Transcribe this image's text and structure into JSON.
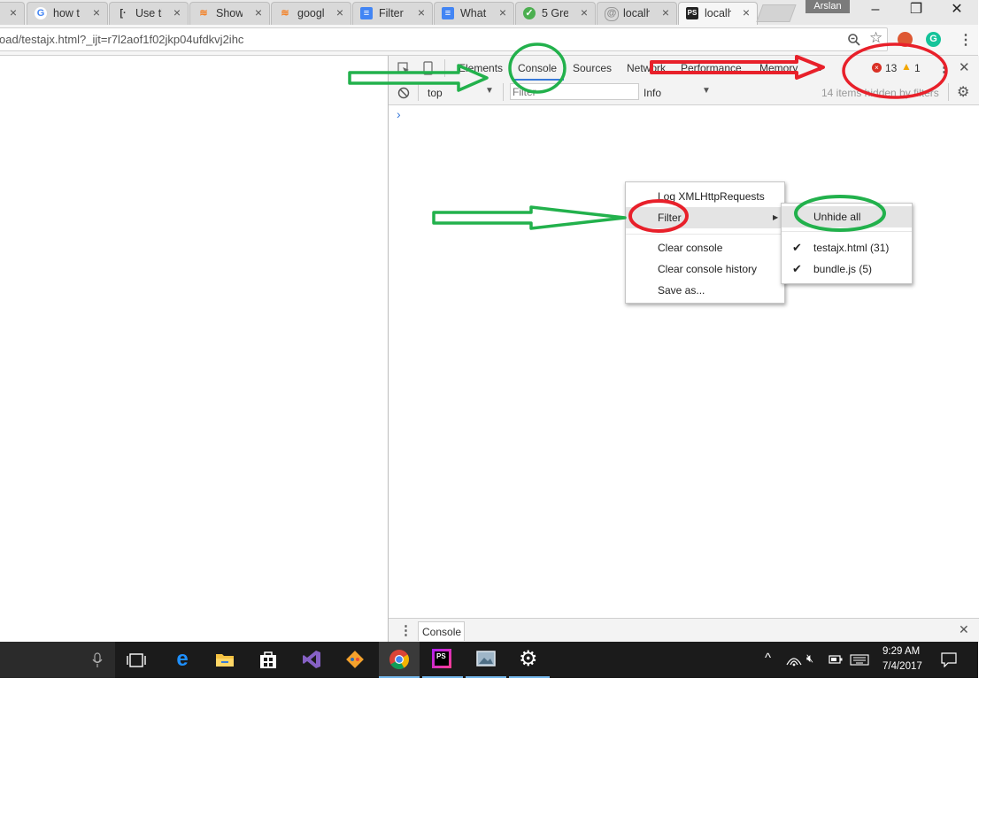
{
  "browser": {
    "tabs": [
      {
        "title": "how t",
        "icon": "google-icon"
      },
      {
        "title": "Use tl",
        "icon": "bracket-icon"
      },
      {
        "title": "Show",
        "icon": "stackoverflow-icon"
      },
      {
        "title": "googl",
        "icon": "stackoverflow-icon"
      },
      {
        "title": "Filter",
        "icon": "docs-icon"
      },
      {
        "title": "What",
        "icon": "docs-icon"
      },
      {
        "title": "5 Gre",
        "icon": "shield-icon"
      },
      {
        "title": "localh",
        "icon": "globe-icon"
      },
      {
        "title": "localh",
        "icon": "phpstorm-icon"
      }
    ],
    "profile_name": "Arslan",
    "url": "oad/testajx.html?_ijt=r7l2aof1f02jkp04ufdkvj2ihc"
  },
  "devtools": {
    "tabs": [
      "Elements",
      "Console",
      "Sources",
      "Network",
      "Performance",
      "Memory"
    ],
    "overflow_label": "»",
    "errors_count": "13",
    "warnings_count": "1",
    "context": "top",
    "filter_placeholder": "Filter",
    "level": "Info",
    "hidden_note": "14 items hidden by filters",
    "prompt": "›",
    "drawer_tab": "Console"
  },
  "context_menu": {
    "items": [
      "Log XMLHttpRequests",
      "Filter",
      "Clear console",
      "Clear console history",
      "Save as..."
    ]
  },
  "filter_submenu": {
    "items": [
      {
        "label": "Unhide all",
        "checked": false
      },
      {
        "label": "testajx.html (31)",
        "checked": true
      },
      {
        "label": "bundle.js (5)",
        "checked": true
      }
    ]
  },
  "taskbar": {
    "time": "9:29 AM",
    "date": "7/4/2017"
  },
  "colors": {
    "annotation_green": "#22b14c",
    "annotation_red": "#e8202a",
    "taskbar_bg": "#1b1b1b"
  }
}
